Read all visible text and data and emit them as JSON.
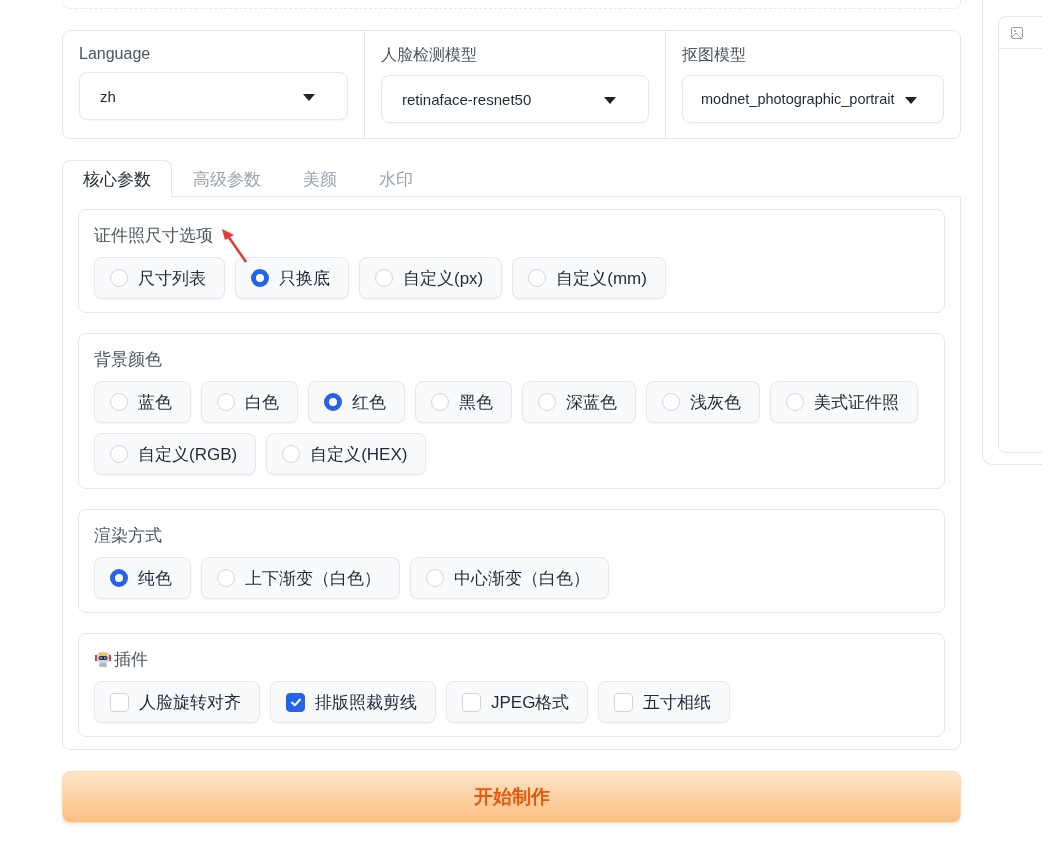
{
  "model_settings": [
    {
      "label": "Language",
      "value": "zh"
    },
    {
      "label": "人脸检测模型",
      "value": "retinaface-resnet50"
    },
    {
      "label": "抠图模型",
      "value": "modnet_photographic_portrait"
    }
  ],
  "tabs": [
    {
      "label": "核心参数",
      "selected": true
    },
    {
      "label": "高级参数",
      "selected": false
    },
    {
      "label": "美颜",
      "selected": false
    },
    {
      "label": "水印",
      "selected": false
    }
  ],
  "groups": [
    {
      "kind": "radio",
      "label": "证件照尺寸选项",
      "has_icon": false,
      "options": [
        {
          "label": "尺寸列表",
          "selected": false
        },
        {
          "label": "只换底",
          "selected": true
        },
        {
          "label": "自定义(px)",
          "selected": false
        },
        {
          "label": "自定义(mm)",
          "selected": false
        }
      ]
    },
    {
      "kind": "radio",
      "label": "背景颜色",
      "has_icon": false,
      "options": [
        {
          "label": "蓝色",
          "selected": false
        },
        {
          "label": "白色",
          "selected": false
        },
        {
          "label": "红色",
          "selected": true
        },
        {
          "label": "黑色",
          "selected": false
        },
        {
          "label": "深蓝色",
          "selected": false
        },
        {
          "label": "浅灰色",
          "selected": false
        },
        {
          "label": "美式证件照",
          "selected": false
        },
        {
          "label": "自定义(RGB)",
          "selected": false
        },
        {
          "label": "自定义(HEX)",
          "selected": false
        }
      ]
    },
    {
      "kind": "radio",
      "label": "渲染方式",
      "has_icon": false,
      "options": [
        {
          "label": "纯色",
          "selected": true
        },
        {
          "label": "上下渐变（白色）",
          "selected": false
        },
        {
          "label": "中心渐变（白色）",
          "selected": false
        }
      ]
    },
    {
      "kind": "checkbox",
      "label": "插件",
      "has_icon": true,
      "options": [
        {
          "label": "人脸旋转对齐",
          "checked": false
        },
        {
          "label": "排版照裁剪线",
          "checked": true
        },
        {
          "label": "JPEG格式",
          "checked": false
        },
        {
          "label": "五寸相纸",
          "checked": false
        }
      ]
    }
  ],
  "submit_button": {
    "label": "开始制作"
  }
}
